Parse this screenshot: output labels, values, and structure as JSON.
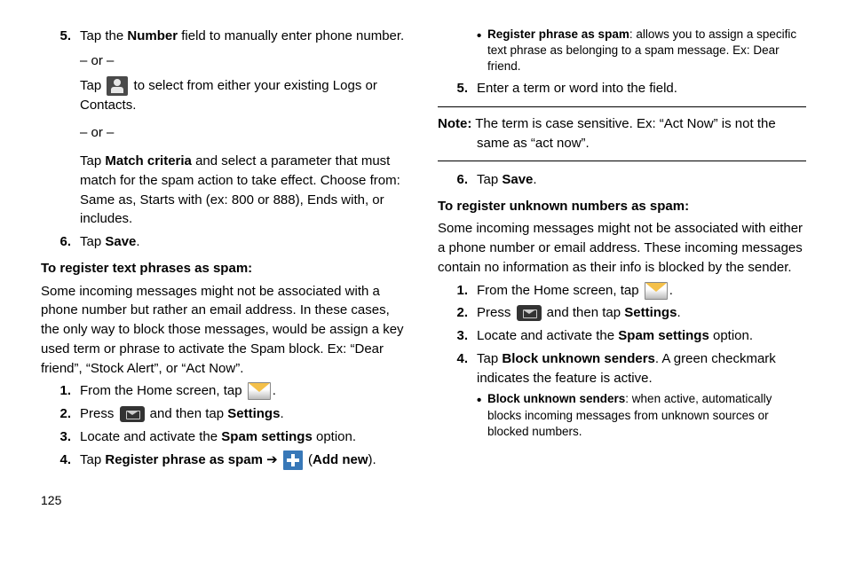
{
  "pageNumber": "125",
  "left": {
    "step5": {
      "num": "5.",
      "line1a": "Tap the ",
      "line1b": "Number",
      "line1c": " field to manually enter phone number.",
      "or1": "– or –",
      "line2a": "Tap ",
      "line2b": " to select from either your existing Logs or Contacts.",
      "or2": "– or –",
      "line3a": "Tap ",
      "line3b": "Match criteria",
      "line3c": " and select a parameter that must match for the spam action to take effect. Choose from: Same as, Starts with (ex: 800 or 888), Ends with, or includes."
    },
    "step6": {
      "num": "6.",
      "a": "Tap ",
      "b": "Save",
      "c": "."
    },
    "h1": "To register text phrases as spam:",
    "p1": "Some incoming messages might not be associated with a phone number but rather an email address. In these cases, the only way to block those messages, would be assign a key used term or phrase to activate the Spam block. Ex: “Dear friend”, “Stock Alert”, or “Act Now”.",
    "l1": {
      "num": "1.",
      "a": "From the Home screen, tap ",
      "b": "."
    },
    "l2": {
      "num": "2.",
      "a": "Press ",
      "b": " and then tap ",
      "c": "Settings",
      "d": "."
    },
    "l3": {
      "num": "3.",
      "a": "Locate and activate the ",
      "b": "Spam settings",
      "c": " option."
    },
    "l4": {
      "num": "4.",
      "a": "Tap ",
      "b": "Register phrase as spam",
      "arrow": " ➔ ",
      "c": " (",
      "d": "Add new",
      "e": ")."
    }
  },
  "right": {
    "bullet": {
      "a": "Register phrase as spam",
      "b": ": allows you to assign a specific text phrase as belonging to a spam message. Ex: Dear friend."
    },
    "r5": {
      "num": "5.",
      "a": "Enter a term or word into the field."
    },
    "note": {
      "label": "Note:",
      "text": " The term is case sensitive. Ex: “Act Now” is not the same as “act now”."
    },
    "r6": {
      "num": "6.",
      "a": "Tap ",
      "b": "Save",
      "c": "."
    },
    "h2": "To register unknown numbers as spam:",
    "p2": "Some incoming messages might not be associated with either a phone number or email address. These incoming messages contain no information as their info is blocked by the sender.",
    "u1": {
      "num": "1.",
      "a": "From the Home screen, tap ",
      "b": "."
    },
    "u2": {
      "num": "2.",
      "a": "Press ",
      "b": " and then tap ",
      "c": "Settings",
      "d": "."
    },
    "u3": {
      "num": "3.",
      "a": "Locate and activate the ",
      "b": "Spam settings",
      "c": " option."
    },
    "u4": {
      "num": "4.",
      "a": "Tap ",
      "b": "Block unknown senders",
      "c": ". A green checkmark indicates the feature is active."
    },
    "ubullet": {
      "a": "Block unknown senders",
      "b": ": when active, automatically blocks incoming messages from unknown sources or blocked numbers."
    }
  }
}
